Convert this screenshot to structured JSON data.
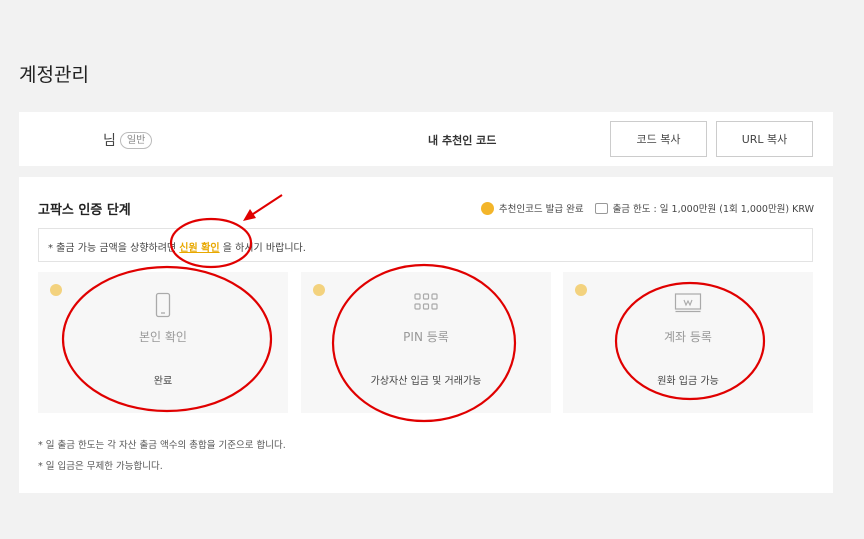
{
  "page_title": "계정관리",
  "account": {
    "name_suffix": "님",
    "grade_badge": "일반",
    "referral_label": "내 추천인 코드",
    "copy_code_button": "코드 복사",
    "copy_url_button": "URL 복사"
  },
  "verification": {
    "title": "고팍스 인증 단계",
    "referral_status": "추천인코드 발급 완료",
    "withdraw_limit": "출금 한도 : 일 1,000만원 (1회 1,000만원) KRW",
    "notice_before": "* 출금 가능 금액을 상향하려면 ",
    "notice_link": "신원 확인",
    "notice_after": " 을 하시기 바랍니다.",
    "steps": [
      {
        "name": "본인 확인",
        "desc": "완료",
        "icon": "phone-icon"
      },
      {
        "name": "PIN 등록",
        "desc": "가상자산 입금 및 거래가능",
        "icon": "pin-grid-icon"
      },
      {
        "name": "계좌 등록",
        "desc": "원화 입금 가능",
        "icon": "bank-account-icon"
      }
    ],
    "footnotes": [
      "* 일 출금 한도는 각 자산 출금 액수의 총합을 기준으로 합니다.",
      "* 일 입금은 무제한 가능합니다."
    ]
  },
  "colors": {
    "accent": "#f3b52a",
    "annotation": "#e00000",
    "background": "#f2f2f2"
  }
}
